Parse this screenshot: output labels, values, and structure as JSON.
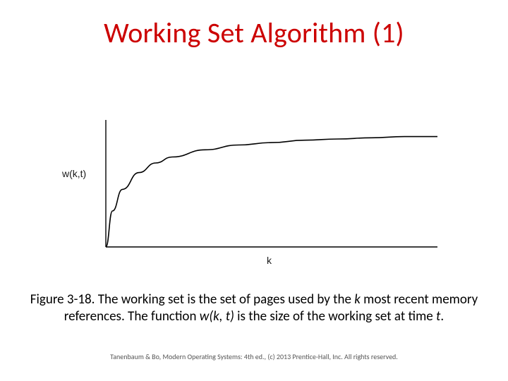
{
  "title": "Working Set Algorithm (1)",
  "chart_data": {
    "type": "line",
    "title": "",
    "xlabel": "k",
    "ylabel": "w(k,t)",
    "xlim": [
      0,
      100
    ],
    "ylim": [
      0,
      100
    ],
    "series": [
      {
        "name": "w(k,t)",
        "x": [
          0,
          2,
          5,
          10,
          15,
          20,
          30,
          40,
          50,
          60,
          70,
          80,
          90,
          100
        ],
        "values": [
          0,
          30,
          48,
          62,
          70,
          75,
          81,
          85,
          87,
          89,
          90,
          91,
          92,
          92
        ]
      }
    ]
  },
  "caption": {
    "pre": "Figure 3-18. The working set is the set of pages used by the ",
    "k": "k",
    "mid1": " most recent memory references. The function ",
    "func": "w(k, t)",
    "mid2": " is the size of the working set at time ",
    "t": "t",
    "post": "."
  },
  "footer": "Tanenbaum & Bo, Modern Operating Systems: 4th ed., (c) 2013 Prentice-Hall, Inc. All rights reserved."
}
